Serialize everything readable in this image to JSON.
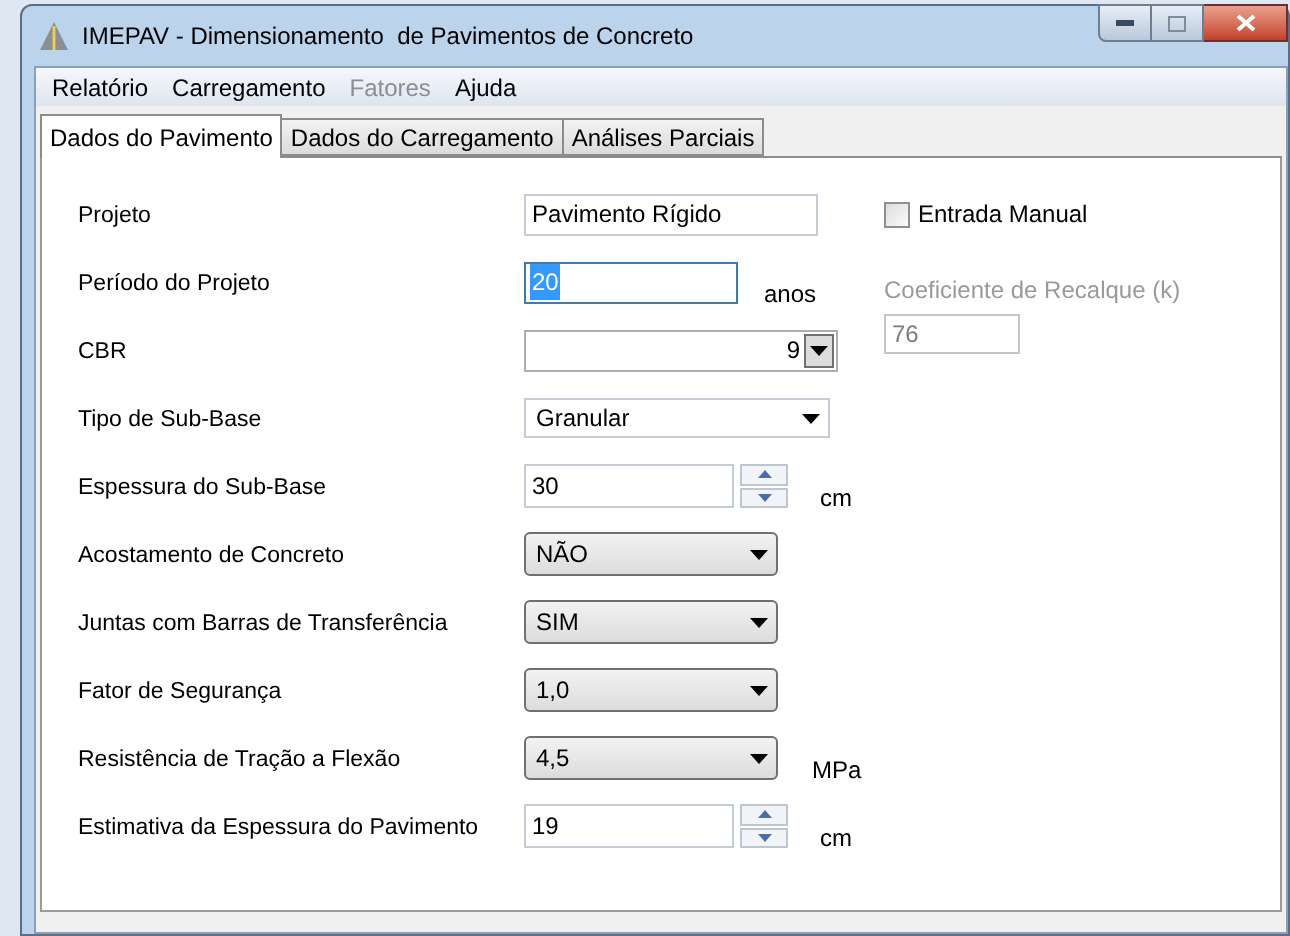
{
  "window": {
    "title": "IMEPAV - Dimensionamento  de Pavimentos de Concreto"
  },
  "menu": [
    {
      "label": "Relatório",
      "disabled": false
    },
    {
      "label": "Carregamento",
      "disabled": false
    },
    {
      "label": "Fatores",
      "disabled": true
    },
    {
      "label": "Ajuda",
      "disabled": false
    }
  ],
  "tabs": [
    {
      "label": "Dados do Pavimento",
      "selected": true
    },
    {
      "label": "Dados do Carregamento",
      "selected": false
    },
    {
      "label": "Análises Parciais",
      "selected": false
    }
  ],
  "fields": [
    {
      "label": "Projeto",
      "kind": "text",
      "value": "Pavimento Rígido",
      "focused": false
    },
    {
      "label": "Período do Projeto",
      "kind": "text",
      "value": "20",
      "focused": true,
      "unit": "anos"
    },
    {
      "label": "CBR",
      "kind": "combo",
      "value": "9",
      "focused": false
    },
    {
      "label": "Tipo de Sub-Base",
      "kind": "flatselect",
      "value": "Granular",
      "focused": false
    },
    {
      "label": "Espessura do Sub-Base",
      "kind": "spinner",
      "value": "30",
      "focused": false,
      "unit": "cm"
    },
    {
      "label": "Acostamento de Concreto",
      "kind": "select",
      "value": "NÃO",
      "focused": false
    },
    {
      "label": "Juntas com Barras de Transferência",
      "kind": "select",
      "value": "SIM",
      "focused": false
    },
    {
      "label": "Fator de Segurança",
      "kind": "select",
      "value": "1,0",
      "focused": false
    },
    {
      "label": "Resistência de Tração a Flexão",
      "kind": "select",
      "value": "4,5",
      "focused": false,
      "unit": "MPa"
    },
    {
      "label": "Estimativa da Espessura do Pavimento",
      "kind": "spinner",
      "value": "19",
      "focused": false,
      "unit": "cm"
    }
  ],
  "manual_entry": {
    "label": "Entrada Manual",
    "checked": false
  },
  "k_field": {
    "label": "Coeficiente de Recalque (k)",
    "value": "76",
    "disabled": true
  }
}
